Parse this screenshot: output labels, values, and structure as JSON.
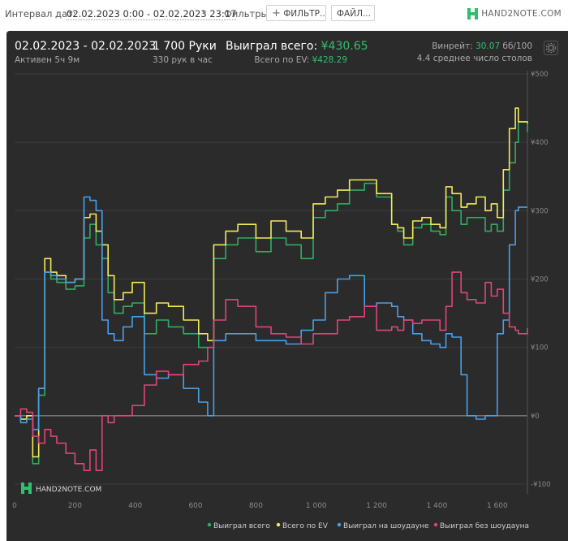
{
  "topbar": {
    "interval_label": "Интервал дат:",
    "interval_value": "02.02.2023 0:00 - 02.02.2023 23:17",
    "filters_label": "Фильтры:",
    "filter_button": "ФИЛЬТР...",
    "file_button": "ФАЙЛ...",
    "logo_text": "HAND2NOTE.COM"
  },
  "summary": {
    "date_range": "02.02.2023 - 02.02.2023",
    "active": "Активен 5ч 9м",
    "hands": "1 700 Руки",
    "hands_per_hour": "330 рук в час",
    "won_label": "Выиграл всего:",
    "won_value": "¥430.65",
    "ev_label": "Всего по EV:",
    "ev_value": "¥428.29",
    "winrate_label": "Винрейт:",
    "winrate_value": "30.07",
    "winrate_unit": "бб/100",
    "tables": "4.4 среднее число столов"
  },
  "watermark": "HAND2NOTE.COM",
  "colors": {
    "won": "#2fae62",
    "ev": "#f2ea5a",
    "showdown": "#4a9fe8",
    "nonshowdown": "#e0457b",
    "accent": "#2fbf6e"
  },
  "chart_data": {
    "type": "line",
    "xlim": [
      0,
      1700
    ],
    "ylim": [
      -100,
      500
    ],
    "x_ticks": [
      0,
      200,
      400,
      600,
      800,
      1000,
      1200,
      1400,
      1600
    ],
    "x_tick_labels": [
      "0",
      "200",
      "400",
      "600",
      "800",
      "1 000",
      "1 200",
      "1 400",
      "1 600"
    ],
    "y_ticks": [
      -100,
      0,
      100,
      200,
      300,
      400,
      500
    ],
    "y_tick_labels": [
      "-¥100",
      "¥0",
      "¥100",
      "¥200",
      "¥300",
      "¥400",
      "¥500"
    ],
    "grid": true,
    "legend_position": "bottom",
    "series": [
      {
        "name": "Выиграл всего",
        "color": "#2fae62",
        "x": [
          0,
          20,
          40,
          60,
          80,
          100,
          120,
          140,
          170,
          200,
          230,
          250,
          270,
          290,
          310,
          330,
          360,
          390,
          430,
          470,
          510,
          560,
          610,
          640,
          660,
          700,
          740,
          800,
          850,
          900,
          950,
          990,
          1030,
          1070,
          1110,
          1160,
          1200,
          1250,
          1270,
          1290,
          1320,
          1350,
          1380,
          1410,
          1430,
          1450,
          1480,
          1500,
          1530,
          1560,
          1580,
          1600,
          1620,
          1640,
          1660,
          1670,
          1700
        ],
        "y": [
          0,
          -5,
          0,
          -70,
          30,
          210,
          200,
          195,
          185,
          190,
          260,
          280,
          250,
          230,
          180,
          150,
          160,
          165,
          120,
          140,
          130,
          120,
          100,
          100,
          230,
          250,
          260,
          240,
          260,
          250,
          230,
          290,
          300,
          310,
          330,
          340,
          320,
          280,
          270,
          250,
          275,
          280,
          270,
          265,
          320,
          300,
          280,
          290,
          290,
          270,
          280,
          270,
          330,
          370,
          400,
          430,
          415
        ]
      },
      {
        "name": "Всего по EV",
        "color": "#f2ea5a",
        "x": [
          0,
          20,
          40,
          60,
          80,
          100,
          120,
          140,
          170,
          200,
          230,
          250,
          270,
          290,
          310,
          330,
          360,
          390,
          430,
          470,
          510,
          560,
          610,
          640,
          660,
          700,
          740,
          800,
          850,
          900,
          950,
          990,
          1030,
          1070,
          1110,
          1160,
          1200,
          1250,
          1270,
          1290,
          1320,
          1350,
          1380,
          1410,
          1430,
          1450,
          1480,
          1500,
          1530,
          1560,
          1580,
          1600,
          1620,
          1640,
          1660,
          1670,
          1700
        ],
        "y": [
          0,
          -5,
          0,
          -60,
          40,
          230,
          210,
          205,
          195,
          200,
          290,
          295,
          270,
          250,
          205,
          170,
          180,
          195,
          150,
          165,
          160,
          140,
          120,
          110,
          250,
          270,
          280,
          260,
          285,
          270,
          260,
          310,
          320,
          330,
          345,
          345,
          325,
          280,
          275,
          260,
          285,
          290,
          280,
          275,
          335,
          325,
          305,
          310,
          320,
          300,
          310,
          290,
          360,
          420,
          450,
          430,
          428
        ]
      },
      {
        "name": "Выиграл на шоудауне",
        "color": "#4a9fe8",
        "x": [
          0,
          20,
          40,
          60,
          80,
          100,
          120,
          140,
          170,
          200,
          230,
          250,
          270,
          290,
          310,
          330,
          360,
          390,
          430,
          470,
          510,
          560,
          610,
          640,
          660,
          700,
          740,
          800,
          850,
          900,
          950,
          990,
          1030,
          1070,
          1110,
          1160,
          1200,
          1250,
          1270,
          1290,
          1320,
          1350,
          1380,
          1410,
          1430,
          1450,
          1480,
          1500,
          1530,
          1560,
          1580,
          1600,
          1620,
          1640,
          1660,
          1670,
          1700
        ],
        "y": [
          0,
          -10,
          -5,
          -20,
          40,
          210,
          205,
          200,
          195,
          200,
          320,
          315,
          300,
          140,
          120,
          110,
          130,
          145,
          60,
          55,
          60,
          40,
          20,
          0,
          110,
          120,
          120,
          110,
          110,
          105,
          125,
          140,
          180,
          200,
          205,
          160,
          165,
          160,
          145,
          140,
          120,
          110,
          105,
          100,
          120,
          115,
          60,
          0,
          -5,
          0,
          0,
          120,
          140,
          250,
          300,
          305,
          305
        ]
      },
      {
        "name": "Выиграл без шоудауна",
        "color": "#e0457b",
        "x": [
          0,
          20,
          40,
          60,
          80,
          100,
          120,
          140,
          170,
          200,
          230,
          250,
          270,
          290,
          310,
          330,
          360,
          390,
          430,
          470,
          510,
          560,
          610,
          640,
          660,
          700,
          740,
          800,
          850,
          900,
          950,
          990,
          1030,
          1070,
          1110,
          1160,
          1200,
          1250,
          1270,
          1290,
          1320,
          1350,
          1380,
          1410,
          1430,
          1450,
          1480,
          1500,
          1530,
          1560,
          1580,
          1600,
          1620,
          1640,
          1660,
          1670,
          1700
        ],
        "y": [
          0,
          10,
          5,
          -30,
          -40,
          -20,
          -30,
          -40,
          -55,
          -70,
          -80,
          -50,
          -80,
          0,
          -10,
          0,
          0,
          15,
          45,
          65,
          60,
          75,
          80,
          100,
          140,
          170,
          160,
          130,
          120,
          115,
          105,
          120,
          120,
          140,
          145,
          160,
          125,
          130,
          125,
          140,
          135,
          140,
          140,
          125,
          160,
          210,
          180,
          170,
          165,
          195,
          175,
          185,
          150,
          130,
          125,
          120,
          128
        ]
      }
    ]
  }
}
